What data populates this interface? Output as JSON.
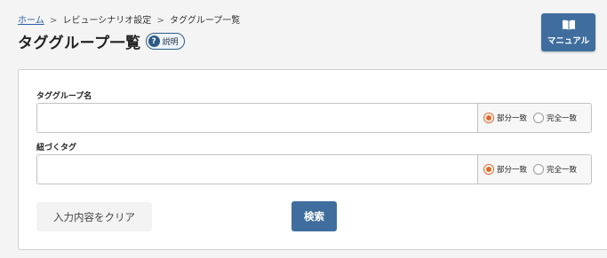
{
  "breadcrumb": {
    "items": [
      "ホーム",
      "レビューシナリオ設定",
      "タググループ一覧"
    ],
    "separator": ">"
  },
  "header": {
    "title": "タググループ一覧",
    "help_label": "説明",
    "help_icon": "?"
  },
  "manual_button": {
    "icon": "book-icon",
    "label": "マニュアル"
  },
  "form": {
    "fields": [
      {
        "label": "タググループ名",
        "value": "",
        "placeholder": "",
        "match_options": [
          {
            "label": "部分一致",
            "selected": true
          },
          {
            "label": "完全一致",
            "selected": false
          }
        ]
      },
      {
        "label": "紐づくタグ",
        "value": "",
        "placeholder": "",
        "match_options": [
          {
            "label": "部分一致",
            "selected": true
          },
          {
            "label": "完全一致",
            "selected": false
          }
        ]
      }
    ],
    "clear_label": "入力内容をクリア",
    "search_label": "検索"
  },
  "colors": {
    "primary": "#3f6e9e",
    "radio_accent": "#e0672a",
    "link": "#2a5fa8"
  }
}
